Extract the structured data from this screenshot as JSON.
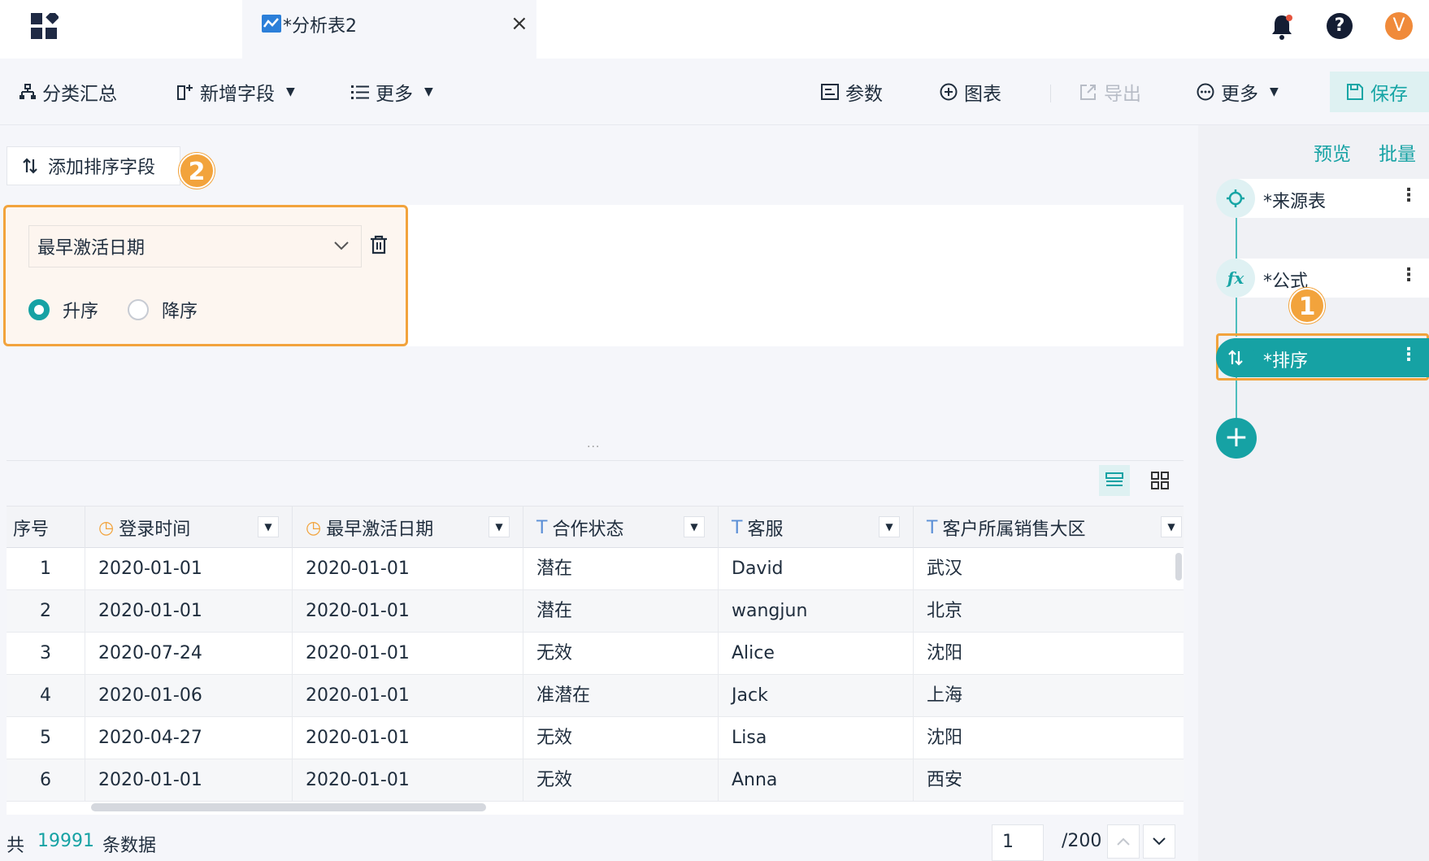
{
  "tab": {
    "title": "*分析表2",
    "close": "×"
  },
  "user": {
    "help": "?",
    "avatar_letter": "V"
  },
  "toolbar": {
    "group_summary": "分类汇总",
    "add_field": "新增字段",
    "more_left": "更多",
    "params": "参数",
    "chart": "图表",
    "export": "导出",
    "more_right": "更多",
    "save": "保存"
  },
  "sort_panel": {
    "add_sort_field": "添加排序字段",
    "badge": "2",
    "selected_field": "最早激活日期",
    "ascending": "升序",
    "descending": "降序",
    "order": "ascending"
  },
  "divider_dots": "...",
  "table": {
    "columns": [
      {
        "label": "序号",
        "type": "none"
      },
      {
        "label": "登录时间",
        "type": "date"
      },
      {
        "label": "最早激活日期",
        "type": "date"
      },
      {
        "label": "合作状态",
        "type": "text"
      },
      {
        "label": "客服",
        "type": "text"
      },
      {
        "label": "客户所属销售大区",
        "type": "text"
      }
    ],
    "rows": [
      [
        "1",
        "2020-01-01",
        "2020-01-01",
        "潜在",
        "David",
        "武汉"
      ],
      [
        "2",
        "2020-01-01",
        "2020-01-01",
        "潜在",
        "wangjun",
        "北京"
      ],
      [
        "3",
        "2020-07-24",
        "2020-01-01",
        "无效",
        "Alice",
        "沈阳"
      ],
      [
        "4",
        "2020-01-06",
        "2020-01-01",
        "准潜在",
        "Jack",
        "上海"
      ],
      [
        "5",
        "2020-04-27",
        "2020-01-01",
        "无效",
        "Lisa",
        "沈阳"
      ],
      [
        "6",
        "2020-01-01",
        "2020-01-01",
        "无效",
        "Anna",
        "西安"
      ]
    ]
  },
  "footer": {
    "total_prefix": "共",
    "total_count": "19991",
    "total_suffix": "条数据",
    "page_current": "1",
    "page_total": "/200"
  },
  "right_panel": {
    "preview": "预览",
    "batch": "批量",
    "steps": [
      {
        "label": "*来源表",
        "icon": "source-icon"
      },
      {
        "label": "*公式",
        "icon": "formula-icon"
      },
      {
        "label": "*排序",
        "icon": "sort-icon",
        "active": true
      }
    ],
    "badge": "1",
    "add": "+"
  },
  "colors": {
    "accent": "#16a2a4",
    "highlight": "#f2a33c",
    "date_icon": "#f2a33c",
    "text_icon": "#5b8fd6"
  }
}
